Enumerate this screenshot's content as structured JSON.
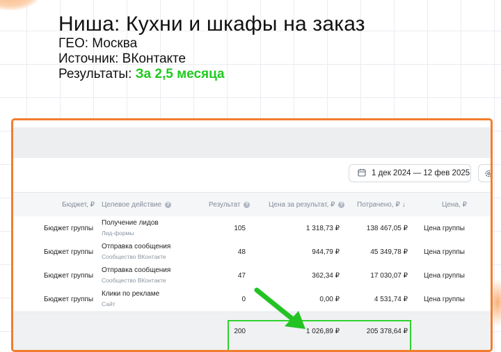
{
  "heading": {
    "title": "Ниша: Кухни и шкафы на заказ",
    "geo": "ГЕО: Москва",
    "source": "Источник: ВКонтакте",
    "results_label": "Результаты:",
    "results_value": "За 2,5 месяца"
  },
  "colors": {
    "frame_border": "#f07e2e",
    "results_green": "#1ec91e",
    "highlight_green": "#2ed32e"
  },
  "toolbar": {
    "calendar_icon": "calendar-icon",
    "date_range": "1 дек 2024 — 12 фев 2025",
    "settings_icon": "gear-icon"
  },
  "table": {
    "headers": {
      "budget": "Бюджет, ₽",
      "target_action": "Целевое действие",
      "result": "Результат",
      "cost_per_result": "Цена за результат, ₽",
      "spent": "Потрачено, ₽ ↓",
      "price": "Цена, ₽"
    },
    "rows": [
      {
        "budget": "Бюджет группы",
        "action": "Получение лидов",
        "action_sub": "Лид-формы",
        "result": "105",
        "cost": "1 318,73 ₽",
        "spent": "138 467,05 ₽",
        "price": "Цена группы"
      },
      {
        "budget": "Бюджет группы",
        "action": "Отправка сообщения",
        "action_sub": "Сообщество ВКонтакте",
        "result": "48",
        "cost": "944,79 ₽",
        "spent": "45 349,78 ₽",
        "price": "Цена группы"
      },
      {
        "budget": "Бюджет группы",
        "action": "Отправка сообщения",
        "action_sub": "Сообщество ВКонтакте",
        "result": "47",
        "cost": "362,34 ₽",
        "spent": "17 030,07 ₽",
        "price": "Цена группы"
      },
      {
        "budget": "Бюджет группы",
        "action": "Клики по рекламе",
        "action_sub": "Сайт",
        "result": "0",
        "cost": "0,00 ₽",
        "spent": "4 531,74 ₽",
        "price": "Цена группы"
      }
    ],
    "totals": {
      "result": "200",
      "cost": "1 026,89 ₽",
      "spent": "205 378,64 ₽"
    }
  }
}
